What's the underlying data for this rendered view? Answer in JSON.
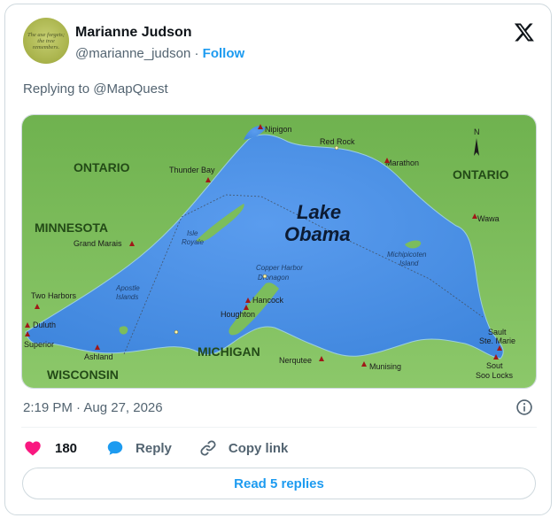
{
  "post": {
    "author_name": "Marianne Judson",
    "handle": "@marianne_judson",
    "separator": "·",
    "follow_label": "Follow",
    "avatar_text": "The axe forgets; the tree remembers.",
    "reply_context": "Replying to @MapQuest",
    "timestamp": "2:19 PM · Aug 27, 2026",
    "like_count": "180",
    "reply_label": "Reply",
    "copy_link_label": "Copy link",
    "read_replies_label": "Read 5 replies"
  },
  "icons": {
    "platform": "x-logo-icon",
    "info": "info-icon",
    "like": "heart-icon",
    "reply": "speech-bubble-icon",
    "copy": "link-icon"
  },
  "colors": {
    "like": "#f91880",
    "reply": "#1d9bf0",
    "link": "#1d9bf0",
    "lake": "#4f93e6",
    "land": "#7ebf5e"
  },
  "map": {
    "lake_name_line1": "Lake",
    "lake_name_line2": "Obama",
    "regions": {
      "ontario_west": "ONTARIO",
      "ontario_east": "ONTARIO",
      "minnesota": "MINNESOTA",
      "wisconsin": "WISCONSIN",
      "michigan": "MICHIGAN"
    },
    "cities": {
      "nipigon": "Nipigon",
      "red_rock": "Red Rock",
      "marathon": "Marathon",
      "thunder_bay": "Thunder Bay",
      "wawa": "Wawa",
      "grand_marais": "Grand Marais",
      "two_harbors": "Two Harbors",
      "duluth": "Duluth",
      "superior": "Superior",
      "ashland": "Ashland",
      "hancock": "Hancock",
      "houghton": "Houghton",
      "nerqutee": "Nerqutee",
      "munising": "Munising",
      "sault_ste_marie_1": "Sault",
      "sault_ste_marie_2": "Ste. Marie",
      "sout_soo_locks_1": "Sout",
      "sout_soo_locks_2": "Soo Locks"
    },
    "islands": {
      "isle_royale_1": "Isle",
      "isle_royale_2": "Royale",
      "apostle_1": "Apostle",
      "apostle_2": "Islands",
      "copper_harbor": "Copper Harbor",
      "dronagon": "Dronagon",
      "michipicoten_1": "Michipicoten",
      "michipicoten_2": "Island"
    },
    "north_label": "N"
  }
}
